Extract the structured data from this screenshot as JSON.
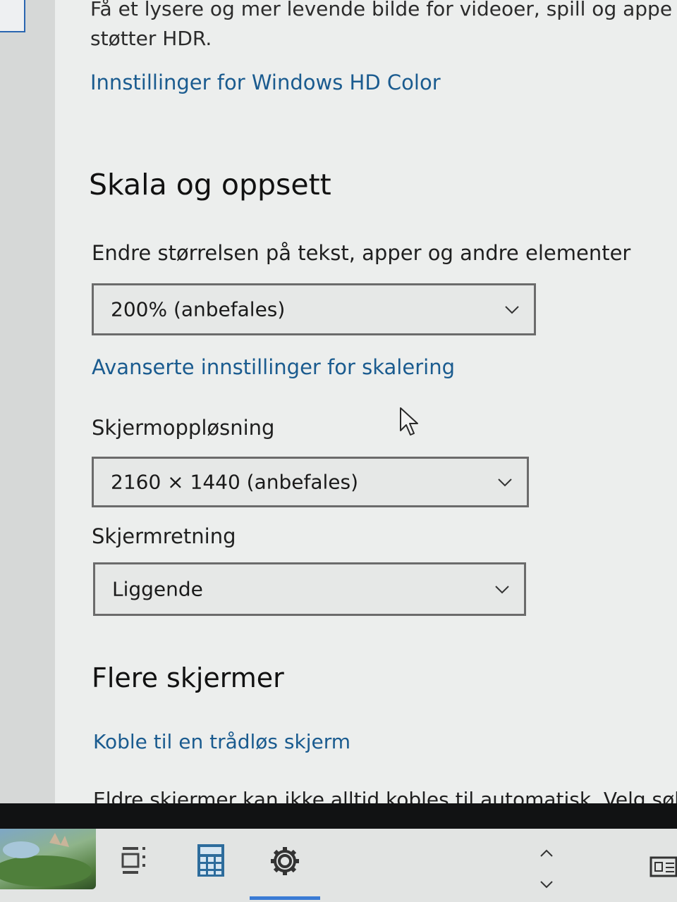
{
  "hdr": {
    "description_line1": "Få et lysere og mer levende bilde for videoer, spill og appe",
    "description_line2": "støtter HDR.",
    "hd_color_link": "Innstillinger for Windows HD Color"
  },
  "scale_layout": {
    "title": "Skala og oppsett",
    "scale_label": "Endre størrelsen på tekst, apper og andre elementer",
    "scale_value": "200% (anbefales)",
    "advanced_scaling_link": "Avanserte innstillinger for skalering",
    "resolution_label": "Skjermoppløsning",
    "resolution_value": "2160 × 1440 (anbefales)",
    "orientation_label": "Skjermretning",
    "orientation_value": "Liggende"
  },
  "multiple_displays": {
    "title": "Flere skjermer",
    "wireless_link": "Koble til en trådløs skjerm",
    "older_displays_text": "Eldre skjermer kan ikke alltid kobles til automatisk. Velg søk fo"
  },
  "taskbar": {
    "items": [
      "wallpaper-thumbnail",
      "task-view-icon",
      "calculator-icon",
      "settings-gear-icon",
      "chevron-up-icon",
      "chevron-down-icon",
      "news-widget-icon"
    ],
    "accent": "#3a7bd5"
  },
  "colors": {
    "link": "#1a5b8f",
    "background": "#eceeed"
  }
}
